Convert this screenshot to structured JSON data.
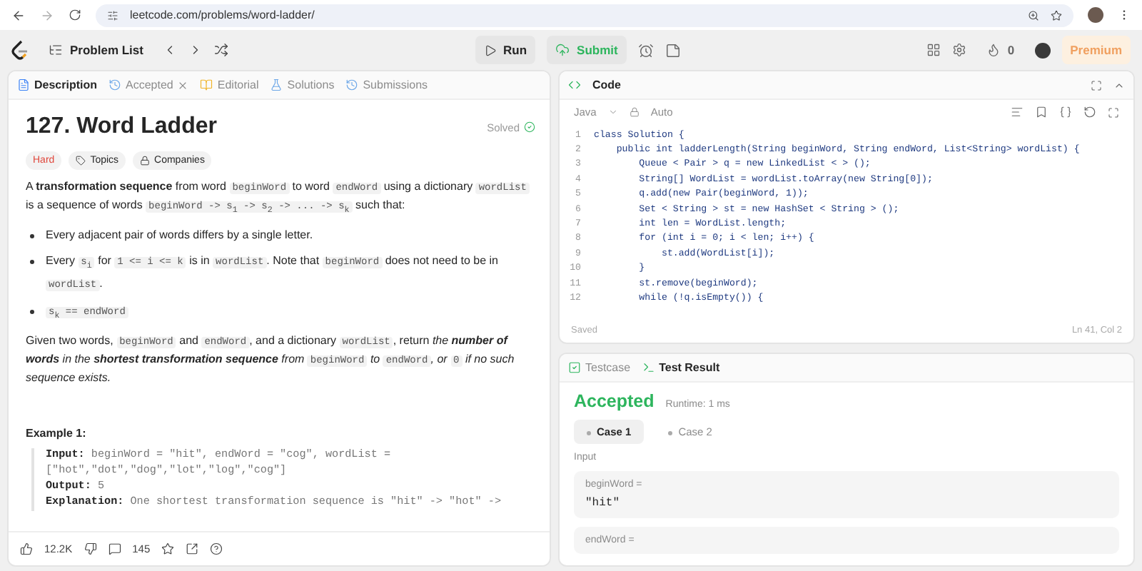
{
  "browser": {
    "url": "leetcode.com/problems/word-ladder/"
  },
  "toolbar": {
    "problem_list": "Problem List",
    "run": "Run",
    "submit": "Submit",
    "streak": "0",
    "premium": "Premium"
  },
  "description": {
    "tabs": [
      {
        "label": "Description",
        "kind": "description",
        "selected": true,
        "closable": false
      },
      {
        "label": "Accepted",
        "kind": "accepted",
        "selected": false,
        "closable": true
      },
      {
        "label": "Editorial",
        "kind": "editorial",
        "selected": false,
        "closable": false
      },
      {
        "label": "Solutions",
        "kind": "solutions",
        "selected": false,
        "closable": false
      },
      {
        "label": "Submissions",
        "kind": "submissions",
        "selected": false,
        "closable": false
      }
    ],
    "title": "127. Word Ladder",
    "status": "Solved",
    "tags": [
      {
        "label": "Hard",
        "kind": "difficulty"
      },
      {
        "label": "Topics",
        "kind": "topics"
      },
      {
        "label": "Companies",
        "kind": "companies"
      }
    ],
    "blocks": [
      {
        "kind": "para",
        "segments": [
          {
            "kind": "text",
            "text": "A "
          },
          {
            "kind": "strong",
            "text": "transformation sequence"
          },
          {
            "kind": "text",
            "text": " from word "
          },
          {
            "kind": "code",
            "text": "beginWord"
          },
          {
            "kind": "text",
            "text": " to word "
          },
          {
            "kind": "code",
            "text": "endWord"
          },
          {
            "kind": "text",
            "text": " using a dictionary "
          },
          {
            "kind": "code",
            "text": "wordList"
          },
          {
            "kind": "text",
            "text": " is a sequence of words "
          },
          {
            "kind": "code",
            "text": "beginWord -> s$_{1}$ -> s$_{2}$ -> ... -> s$_{k}$"
          },
          {
            "kind": "text",
            "text": " such that:"
          }
        ]
      },
      {
        "kind": "bullet",
        "segments": [
          {
            "kind": "text",
            "text": "Every adjacent pair of words differs by a single letter."
          }
        ]
      },
      {
        "kind": "bullet",
        "segments": [
          {
            "kind": "text",
            "text": "Every "
          },
          {
            "kind": "code",
            "text": "s$_{i}$"
          },
          {
            "kind": "text",
            "text": " for "
          },
          {
            "kind": "code",
            "text": "1 <= i <= k"
          },
          {
            "kind": "text",
            "text": " is in "
          },
          {
            "kind": "code",
            "text": "wordList"
          },
          {
            "kind": "text",
            "text": ". Note that "
          },
          {
            "kind": "code",
            "text": "beginWord"
          },
          {
            "kind": "text",
            "text": " does not need to be in "
          },
          {
            "kind": "code",
            "text": "wordList"
          },
          {
            "kind": "text",
            "text": "."
          }
        ]
      },
      {
        "kind": "bullet",
        "segments": [
          {
            "kind": "code",
            "text": "s$_{k}$ == endWord"
          }
        ]
      },
      {
        "kind": "para",
        "segments": [
          {
            "kind": "text",
            "text": "Given two words, "
          },
          {
            "kind": "code",
            "text": "beginWord"
          },
          {
            "kind": "text",
            "text": " and "
          },
          {
            "kind": "code",
            "text": "endWord"
          },
          {
            "kind": "text",
            "text": ", and a dictionary "
          },
          {
            "kind": "code",
            "text": "wordList"
          },
          {
            "kind": "text",
            "text": ", return "
          },
          {
            "kind": "em",
            "text": "the "
          },
          {
            "kind": "strong-em",
            "text": "number of words"
          },
          {
            "kind": "em",
            "text": " in the "
          },
          {
            "kind": "strong-em",
            "text": "shortest transformation sequence"
          },
          {
            "kind": "em",
            "text": " from "
          },
          {
            "kind": "code",
            "text": "beginWord"
          },
          {
            "kind": "em",
            "text": " to "
          },
          {
            "kind": "code",
            "text": "endWord"
          },
          {
            "kind": "em",
            "text": ", or "
          },
          {
            "kind": "code",
            "text": "0"
          },
          {
            "kind": "em",
            "text": " if no such sequence exists."
          }
        ]
      }
    ],
    "example": {
      "heading": "Example 1:",
      "lines": [
        {
          "label": "Input:",
          "text": "beginWord = \"hit\", endWord = \"cog\", wordList = [\"hot\",\"dot\",\"dog\",\"lot\",\"log\",\"cog\"]"
        },
        {
          "label": "Output:",
          "text": "5"
        },
        {
          "label": "Explanation:",
          "text": "One shortest transformation sequence is \"hit\" -> \"hot\" ->"
        }
      ]
    },
    "footer": {
      "likes": "12.2K",
      "comments": "145"
    }
  },
  "code": {
    "title": "Code",
    "language": "Java",
    "mode": "Auto",
    "status": "Saved",
    "position": "Ln 41, Col 2",
    "lines": [
      {
        "no": "1",
        "text": "class Solution {"
      },
      {
        "no": "2",
        "text": "    public int ladderLength(String beginWord, String endWord, List<String> wordList) {"
      },
      {
        "no": "3",
        "text": "        Queue < Pair > q = new LinkedList < > ();"
      },
      {
        "no": "4",
        "text": "        String[] WordList = wordList.toArray(new String[0]);"
      },
      {
        "no": "5",
        "text": "        q.add(new Pair(beginWord, 1));"
      },
      {
        "no": "6",
        "text": "        Set < String > st = new HashSet < String > ();"
      },
      {
        "no": "7",
        "text": "        int len = WordList.length;"
      },
      {
        "no": "8",
        "text": "        for (int i = 0; i < len; i++) {"
      },
      {
        "no": "9",
        "text": "            st.add(WordList[i]);"
      },
      {
        "no": "10",
        "text": "        }"
      },
      {
        "no": "11",
        "text": "        st.remove(beginWord);"
      },
      {
        "no": "12",
        "text": "        while (!q.isEmpty()) {"
      }
    ]
  },
  "test": {
    "tabs": [
      {
        "label": "Testcase",
        "kind": "testcase",
        "selected": false
      },
      {
        "label": "Test Result",
        "kind": "result",
        "selected": true
      }
    ],
    "verdict": "Accepted",
    "runtime": "Runtime: 1 ms",
    "cases": [
      {
        "label": "Case 1",
        "selected": true
      },
      {
        "label": "Case 2",
        "selected": false
      }
    ],
    "input_label": "Input",
    "params": [
      {
        "name": "beginWord =",
        "value": "\"hit\""
      },
      {
        "name": "endWord ="
      }
    ]
  }
}
